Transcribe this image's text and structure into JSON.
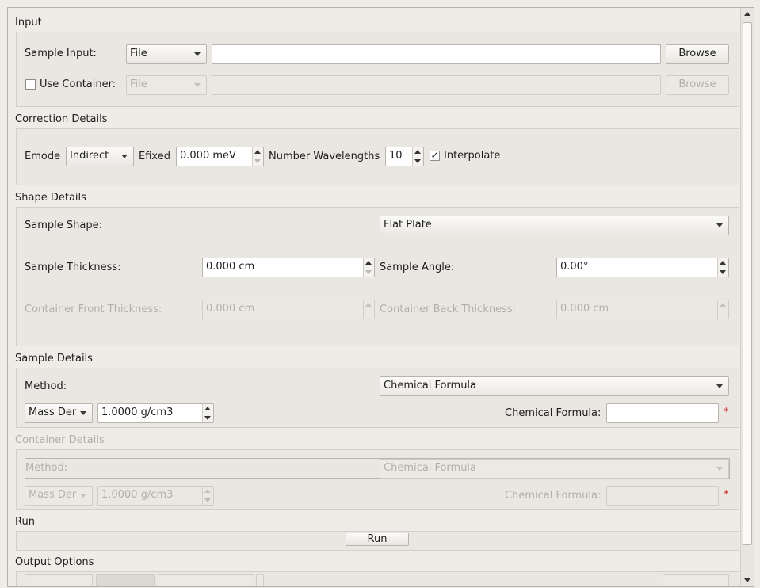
{
  "input": {
    "title": "Input",
    "sample_input_label": "Sample Input:",
    "sample_input_mode": "File",
    "sample_input_value": "",
    "sample_browse": "Browse",
    "use_container_label": "Use Container:",
    "use_container_checked": false,
    "container_mode": "File",
    "container_value": "",
    "container_browse": "Browse"
  },
  "correction": {
    "title": "Correction Details",
    "emode_label": "Emode",
    "emode_value": "Indirect",
    "efixed_label": "Efixed",
    "efixed_value": "0.000 meV",
    "num_wavelengths_label": "Number Wavelengths",
    "num_wavelengths_value": "10",
    "interpolate_label": "Interpolate",
    "interpolate_checked": true,
    "check_glyph": "✓"
  },
  "shape": {
    "title": "Shape Details",
    "sample_shape_label": "Sample Shape:",
    "sample_shape_value": "Flat Plate",
    "sample_thickness_label": "Sample Thickness:",
    "sample_thickness_value": "0.000 cm",
    "sample_angle_label": "Sample Angle:",
    "sample_angle_value": "0.00°",
    "container_front_label": "Container Front Thickness:",
    "container_front_value": "0.000 cm",
    "container_back_label": "Container Back Thickness:",
    "container_back_value": "0.000 cm"
  },
  "sample_details": {
    "title": "Sample Details",
    "method_label": "Method:",
    "method_value": "Chemical Formula",
    "density_type": "Mass Der",
    "density_value": "1.0000 g/cm3",
    "formula_label": "Chemical Formula:",
    "formula_value": "",
    "required_mark": "*"
  },
  "container_details": {
    "title": "Container Details",
    "method_label": "Method:",
    "method_value": "Chemical Formula",
    "density_type": "Mass Der",
    "density_value": "1.0000 g/cm3",
    "formula_label": "Chemical Formula:",
    "formula_value": "",
    "required_mark": "*"
  },
  "run": {
    "title": "Run",
    "run_button": "Run"
  },
  "output": {
    "title": "Output Options"
  },
  "colors": {
    "background": "#efebe7",
    "required": "#d01b1b",
    "disabled_text": "#b2afab"
  }
}
